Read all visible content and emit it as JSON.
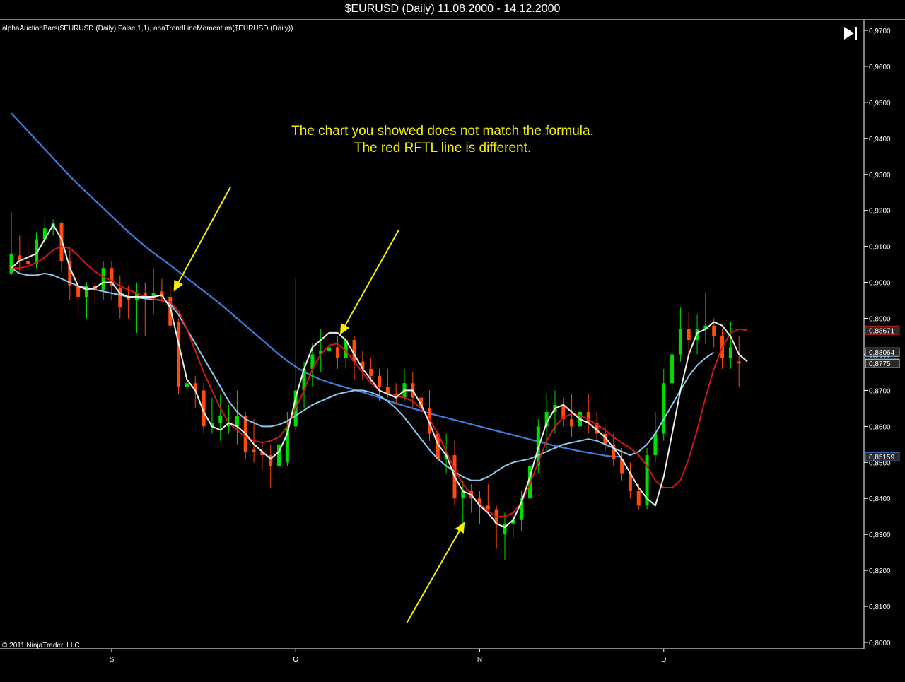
{
  "window": {
    "title": "$EURUSD (Daily)  11.08.2000 - 14.12.2000"
  },
  "chart_data": {
    "type": "candlestick",
    "indicator_label": "alphaAuctionBars($EURUSD  (Daily),False,1,1),  anaTrendLineMomentum($EURUSD  (Daily))",
    "copyright": "© 2011 NinjaTrader, LLC",
    "annotation": [
      "The chart you showed does not match the formula.",
      "The red RFTL line is different."
    ],
    "ylim": [
      0.8,
      0.97
    ],
    "y_ticks": [
      0.97,
      0.96,
      0.95,
      0.94,
      0.93,
      0.92,
      0.91,
      0.9,
      0.89,
      0.88,
      0.87,
      0.86,
      0.85,
      0.84,
      0.83,
      0.82,
      0.81,
      0.8
    ],
    "y_tick_labels": [
      "0,9700",
      "0,9600",
      "0,9500",
      "0,9400",
      "0,9300",
      "0,9200",
      "0,9100",
      "0,9000",
      "0,8900",
      "0,8800",
      "0,8700",
      "0,8600",
      "0,8500",
      "0,8400",
      "0,8300",
      "0,8200",
      "0,8100",
      "0,8000"
    ],
    "x_ticks": [
      {
        "index": 12,
        "label": "S"
      },
      {
        "index": 34,
        "label": "O"
      },
      {
        "index": 56,
        "label": "N"
      },
      {
        "index": 78,
        "label": "D"
      }
    ],
    "price_badges": [
      {
        "value": 0.88671,
        "label": "0,88671",
        "color": "#d01818"
      },
      {
        "value": 0.88064,
        "label": "0,88064",
        "color": "#8ec8f0"
      },
      {
        "value": 0.8775,
        "label": "0,8775",
        "color": "#e8e8e8"
      },
      {
        "value": 0.85159,
        "label": "0,85159",
        "color": "#3a7fe0"
      }
    ],
    "colors": {
      "up": "#00dd00",
      "down": "#ff4a10",
      "momentum": "#f0f0f0",
      "rftl": "#d01818",
      "slow_ma": "#8ec8f0",
      "long_ma": "#3a7fe0",
      "arrow": "#f4f000",
      "axis": "#ffffff"
    },
    "candles": [
      {
        "o": 0.9025,
        "h": 0.9195,
        "l": 0.902,
        "c": 0.908
      },
      {
        "o": 0.9075,
        "h": 0.913,
        "l": 0.903,
        "c": 0.906
      },
      {
        "o": 0.906,
        "h": 0.911,
        "l": 0.904,
        "c": 0.905
      },
      {
        "o": 0.905,
        "h": 0.914,
        "l": 0.904,
        "c": 0.912
      },
      {
        "o": 0.912,
        "h": 0.918,
        "l": 0.91,
        "c": 0.915
      },
      {
        "o": 0.915,
        "h": 0.9175,
        "l": 0.913,
        "c": 0.9165
      },
      {
        "o": 0.9165,
        "h": 0.917,
        "l": 0.903,
        "c": 0.906
      },
      {
        "o": 0.906,
        "h": 0.909,
        "l": 0.895,
        "c": 0.899
      },
      {
        "o": 0.899,
        "h": 0.902,
        "l": 0.891,
        "c": 0.896
      },
      {
        "o": 0.896,
        "h": 0.9,
        "l": 0.89,
        "c": 0.899
      },
      {
        "o": 0.899,
        "h": 0.9,
        "l": 0.894,
        "c": 0.898
      },
      {
        "o": 0.898,
        "h": 0.906,
        "l": 0.895,
        "c": 0.904
      },
      {
        "o": 0.904,
        "h": 0.906,
        "l": 0.895,
        "c": 0.899
      },
      {
        "o": 0.8985,
        "h": 0.902,
        "l": 0.89,
        "c": 0.893
      },
      {
        "o": 0.896,
        "h": 0.899,
        "l": 0.89,
        "c": 0.895
      },
      {
        "o": 0.895,
        "h": 0.9,
        "l": 0.886,
        "c": 0.897
      },
      {
        "o": 0.897,
        "h": 0.9,
        "l": 0.885,
        "c": 0.896
      },
      {
        "o": 0.896,
        "h": 0.904,
        "l": 0.891,
        "c": 0.897
      },
      {
        "o": 0.8975,
        "h": 0.901,
        "l": 0.895,
        "c": 0.896
      },
      {
        "o": 0.896,
        "h": 0.899,
        "l": 0.887,
        "c": 0.888
      },
      {
        "o": 0.889,
        "h": 0.89,
        "l": 0.869,
        "c": 0.871
      },
      {
        "o": 0.871,
        "h": 0.877,
        "l": 0.863,
        "c": 0.872
      },
      {
        "o": 0.872,
        "h": 0.874,
        "l": 0.865,
        "c": 0.87
      },
      {
        "o": 0.87,
        "h": 0.872,
        "l": 0.858,
        "c": 0.86
      },
      {
        "o": 0.86,
        "h": 0.868,
        "l": 0.858,
        "c": 0.861
      },
      {
        "o": 0.861,
        "h": 0.869,
        "l": 0.856,
        "c": 0.863
      },
      {
        "o": 0.86,
        "h": 0.866,
        "l": 0.858,
        "c": 0.861
      },
      {
        "o": 0.86,
        "h": 0.87,
        "l": 0.855,
        "c": 0.863
      },
      {
        "o": 0.863,
        "h": 0.864,
        "l": 0.851,
        "c": 0.853
      },
      {
        "o": 0.8535,
        "h": 0.862,
        "l": 0.85,
        "c": 0.853
      },
      {
        "o": 0.853,
        "h": 0.856,
        "l": 0.848,
        "c": 0.852
      },
      {
        "o": 0.852,
        "h": 0.855,
        "l": 0.843,
        "c": 0.849
      },
      {
        "o": 0.849,
        "h": 0.857,
        "l": 0.845,
        "c": 0.855
      },
      {
        "o": 0.85,
        "h": 0.864,
        "l": 0.849,
        "c": 0.86
      },
      {
        "o": 0.86,
        "h": 0.901,
        "l": 0.859,
        "c": 0.87
      },
      {
        "o": 0.87,
        "h": 0.878,
        "l": 0.865,
        "c": 0.876
      },
      {
        "o": 0.876,
        "h": 0.883,
        "l": 0.871,
        "c": 0.88
      },
      {
        "o": 0.88,
        "h": 0.887,
        "l": 0.875,
        "c": 0.881
      },
      {
        "o": 0.881,
        "h": 0.883,
        "l": 0.876,
        "c": 0.882
      },
      {
        "o": 0.882,
        "h": 0.885,
        "l": 0.876,
        "c": 0.879
      },
      {
        "o": 0.879,
        "h": 0.885,
        "l": 0.876,
        "c": 0.884
      },
      {
        "o": 0.884,
        "h": 0.885,
        "l": 0.873,
        "c": 0.878
      },
      {
        "o": 0.878,
        "h": 0.881,
        "l": 0.873,
        "c": 0.876
      },
      {
        "o": 0.876,
        "h": 0.879,
        "l": 0.872,
        "c": 0.874
      },
      {
        "o": 0.874,
        "h": 0.876,
        "l": 0.867,
        "c": 0.871
      },
      {
        "o": 0.871,
        "h": 0.876,
        "l": 0.868,
        "c": 0.869
      },
      {
        "o": 0.869,
        "h": 0.872,
        "l": 0.866,
        "c": 0.868
      },
      {
        "o": 0.868,
        "h": 0.876,
        "l": 0.867,
        "c": 0.872
      },
      {
        "o": 0.872,
        "h": 0.875,
        "l": 0.865,
        "c": 0.868
      },
      {
        "o": 0.868,
        "h": 0.869,
        "l": 0.862,
        "c": 0.865
      },
      {
        "o": 0.865,
        "h": 0.87,
        "l": 0.856,
        "c": 0.858
      },
      {
        "o": 0.858,
        "h": 0.862,
        "l": 0.849,
        "c": 0.851
      },
      {
        "o": 0.851,
        "h": 0.858,
        "l": 0.847,
        "c": 0.853
      },
      {
        "o": 0.852,
        "h": 0.856,
        "l": 0.838,
        "c": 0.84
      },
      {
        "o": 0.84,
        "h": 0.845,
        "l": 0.833,
        "c": 0.842
      },
      {
        "o": 0.842,
        "h": 0.844,
        "l": 0.836,
        "c": 0.84
      },
      {
        "o": 0.84,
        "h": 0.842,
        "l": 0.833,
        "c": 0.838
      },
      {
        "o": 0.838,
        "h": 0.844,
        "l": 0.836,
        "c": 0.837
      },
      {
        "o": 0.837,
        "h": 0.838,
        "l": 0.826,
        "c": 0.833
      },
      {
        "o": 0.83,
        "h": 0.836,
        "l": 0.823,
        "c": 0.833
      },
      {
        "o": 0.833,
        "h": 0.835,
        "l": 0.829,
        "c": 0.834
      },
      {
        "o": 0.834,
        "h": 0.842,
        "l": 0.831,
        "c": 0.84
      },
      {
        "o": 0.84,
        "h": 0.856,
        "l": 0.839,
        "c": 0.849
      },
      {
        "o": 0.849,
        "h": 0.862,
        "l": 0.847,
        "c": 0.86
      },
      {
        "o": 0.86,
        "h": 0.869,
        "l": 0.853,
        "c": 0.864
      },
      {
        "o": 0.864,
        "h": 0.87,
        "l": 0.858,
        "c": 0.866
      },
      {
        "o": 0.866,
        "h": 0.868,
        "l": 0.86,
        "c": 0.862
      },
      {
        "o": 0.862,
        "h": 0.869,
        "l": 0.857,
        "c": 0.86
      },
      {
        "o": 0.86,
        "h": 0.866,
        "l": 0.856,
        "c": 0.864
      },
      {
        "o": 0.864,
        "h": 0.869,
        "l": 0.858,
        "c": 0.861
      },
      {
        "o": 0.861,
        "h": 0.864,
        "l": 0.856,
        "c": 0.858
      },
      {
        "o": 0.858,
        "h": 0.86,
        "l": 0.853,
        "c": 0.855
      },
      {
        "o": 0.855,
        "h": 0.858,
        "l": 0.849,
        "c": 0.851
      },
      {
        "o": 0.851,
        "h": 0.854,
        "l": 0.845,
        "c": 0.847
      },
      {
        "o": 0.847,
        "h": 0.85,
        "l": 0.84,
        "c": 0.842
      },
      {
        "o": 0.842,
        "h": 0.844,
        "l": 0.837,
        "c": 0.838
      },
      {
        "o": 0.838,
        "h": 0.854,
        "l": 0.837,
        "c": 0.852
      },
      {
        "o": 0.852,
        "h": 0.864,
        "l": 0.85,
        "c": 0.858
      },
      {
        "o": 0.858,
        "h": 0.876,
        "l": 0.856,
        "c": 0.872
      },
      {
        "o": 0.872,
        "h": 0.884,
        "l": 0.87,
        "c": 0.88
      },
      {
        "o": 0.88,
        "h": 0.893,
        "l": 0.878,
        "c": 0.887
      },
      {
        "o": 0.887,
        "h": 0.892,
        "l": 0.88,
        "c": 0.884
      },
      {
        "o": 0.884,
        "h": 0.891,
        "l": 0.88,
        "c": 0.887
      },
      {
        "o": 0.887,
        "h": 0.897,
        "l": 0.883,
        "c": 0.888
      },
      {
        "o": 0.888,
        "h": 0.89,
        "l": 0.882,
        "c": 0.885
      },
      {
        "o": 0.885,
        "h": 0.887,
        "l": 0.876,
        "c": 0.879
      },
      {
        "o": 0.879,
        "h": 0.889,
        "l": 0.876,
        "c": 0.882
      },
      {
        "o": 0.878,
        "h": 0.885,
        "l": 0.871,
        "c": 0.8775
      }
    ],
    "series": [
      {
        "key": "momentum",
        "values": [
          0.904,
          0.906,
          0.907,
          0.908,
          0.912,
          0.916,
          0.912,
          0.904,
          0.899,
          0.898,
          0.8985,
          0.9,
          0.9,
          0.897,
          0.896,
          0.896,
          0.896,
          0.896,
          0.8965,
          0.893,
          0.883,
          0.873,
          0.87,
          0.864,
          0.86,
          0.859,
          0.861,
          0.86,
          0.858,
          0.855,
          0.853,
          0.851,
          0.853,
          0.858,
          0.868,
          0.876,
          0.882,
          0.884,
          0.886,
          0.886,
          0.884,
          0.88,
          0.876,
          0.873,
          0.87,
          0.869,
          0.868,
          0.87,
          0.87,
          0.866,
          0.861,
          0.855,
          0.852,
          0.846,
          0.842,
          0.841,
          0.838,
          0.836,
          0.833,
          0.832,
          0.834,
          0.839,
          0.846,
          0.854,
          0.861,
          0.865,
          0.866,
          0.864,
          0.862,
          0.861,
          0.859,
          0.857,
          0.854,
          0.851,
          0.847,
          0.843,
          0.84,
          0.838,
          0.846,
          0.858,
          0.87,
          0.88,
          0.886,
          0.887,
          0.889,
          0.888,
          0.885,
          0.88,
          0.878
        ]
      },
      {
        "key": "rftl",
        "values": [
          0.904,
          0.904,
          0.9045,
          0.9055,
          0.907,
          0.909,
          0.91,
          0.9095,
          0.9075,
          0.905,
          0.903,
          0.9015,
          0.9005,
          0.899,
          0.898,
          0.897,
          0.896,
          0.8955,
          0.895,
          0.8945,
          0.892,
          0.887,
          0.881,
          0.875,
          0.87,
          0.865,
          0.861,
          0.859,
          0.857,
          0.856,
          0.8555,
          0.856,
          0.857,
          0.86,
          0.865,
          0.87,
          0.876,
          0.88,
          0.8825,
          0.883,
          0.881,
          0.878,
          0.875,
          0.872,
          0.87,
          0.869,
          0.8685,
          0.868,
          0.867,
          0.865,
          0.862,
          0.858,
          0.853,
          0.848,
          0.844,
          0.841,
          0.8385,
          0.8365,
          0.835,
          0.835,
          0.836,
          0.839,
          0.844,
          0.85,
          0.856,
          0.86,
          0.8625,
          0.8635,
          0.863,
          0.862,
          0.8605,
          0.859,
          0.857,
          0.8555,
          0.854,
          0.852,
          0.849,
          0.845,
          0.843,
          0.843,
          0.845,
          0.851,
          0.859,
          0.868,
          0.876,
          0.882,
          0.886,
          0.887,
          0.8867
        ]
      },
      {
        "key": "slow_ma",
        "values": [
          0.904,
          0.9025,
          0.902,
          0.902,
          0.9025,
          0.902,
          0.901,
          0.9,
          0.899,
          0.8985,
          0.898,
          0.8975,
          0.897,
          0.8965,
          0.896,
          0.8958,
          0.8955,
          0.8953,
          0.895,
          0.894,
          0.891,
          0.887,
          0.883,
          0.879,
          0.875,
          0.871,
          0.867,
          0.864,
          0.862,
          0.861,
          0.86,
          0.86,
          0.8605,
          0.8615,
          0.863,
          0.8645,
          0.866,
          0.867,
          0.868,
          0.869,
          0.8695,
          0.87,
          0.87,
          0.8695,
          0.8685,
          0.867,
          0.865,
          0.8625,
          0.8595,
          0.8565,
          0.8535,
          0.851,
          0.849,
          0.8475,
          0.846,
          0.845,
          0.845,
          0.846,
          0.8475,
          0.849,
          0.85,
          0.8505,
          0.851,
          0.852,
          0.853,
          0.854,
          0.855,
          0.8555,
          0.856,
          0.8565,
          0.856,
          0.855,
          0.854,
          0.853,
          0.852,
          0.853,
          0.855,
          0.858,
          0.862,
          0.866,
          0.87,
          0.874,
          0.877,
          0.879,
          0.8806
        ]
      },
      {
        "key": "long_ma",
        "values": [
          0.947,
          0.9445,
          0.942,
          0.9395,
          0.937,
          0.9345,
          0.932,
          0.9295,
          0.9272,
          0.925,
          0.9228,
          0.9206,
          0.9184,
          0.9162,
          0.914,
          0.912,
          0.91,
          0.9082,
          0.9065,
          0.9048,
          0.903,
          0.9012,
          0.8994,
          0.8976,
          0.8958,
          0.894,
          0.892,
          0.89,
          0.888,
          0.886,
          0.884,
          0.882,
          0.88,
          0.8782,
          0.8766,
          0.8752,
          0.874,
          0.873,
          0.8722,
          0.8715,
          0.8708,
          0.8702,
          0.8695,
          0.8688,
          0.868,
          0.8672,
          0.8664,
          0.8657,
          0.865,
          0.8643,
          0.8636,
          0.863,
          0.8624,
          0.8618,
          0.8612,
          0.8606,
          0.86,
          0.8594,
          0.8588,
          0.8582,
          0.8576,
          0.857,
          0.8564,
          0.8558,
          0.8552,
          0.8546,
          0.8541,
          0.8536,
          0.8531,
          0.8527,
          0.8523,
          0.8519,
          0.8516,
          0.8516
        ]
      }
    ],
    "arrows": [
      {
        "x1i": 26.2,
        "y1": 0.9265,
        "x2i": 19.4,
        "y2": 0.8975
      },
      {
        "x1i": 46.3,
        "y1": 0.9145,
        "x2i": 39.3,
        "y2": 0.8855
      },
      {
        "x1i": 47.3,
        "y1": 0.8055,
        "x2i": 54.2,
        "y2": 0.8335
      }
    ]
  }
}
